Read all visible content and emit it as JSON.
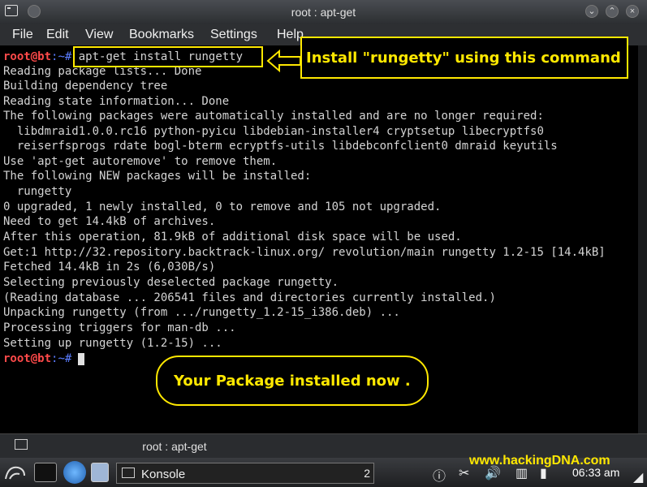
{
  "window": {
    "title": "root : apt-get",
    "menu": [
      "File",
      "Edit",
      "View",
      "Bookmarks",
      "Settings",
      "Help"
    ]
  },
  "terminal": {
    "prompt_user": "root@bt",
    "prompt_path": ":~#",
    "command": "apt-get install rungetty",
    "lines": [
      "Reading package lists... Done",
      "Building dependency tree",
      "Reading state information... Done",
      "The following packages were automatically installed and are no longer required:",
      "  libdmraid1.0.0.rc16 python-pyicu libdebian-installer4 cryptsetup libecryptfs0",
      "  reiserfsprogs rdate bogl-bterm ecryptfs-utils libdebconfclient0 dmraid keyutils",
      "Use 'apt-get autoremove' to remove them.",
      "The following NEW packages will be installed:",
      "  rungetty",
      "0 upgraded, 1 newly installed, 0 to remove and 105 not upgraded.",
      "Need to get 14.4kB of archives.",
      "After this operation, 81.9kB of additional disk space will be used.",
      "Get:1 http://32.repository.backtrack-linux.org/ revolution/main rungetty 1.2-15 [14.4kB]",
      "Fetched 14.4kB in 2s (6,030B/s)",
      "Selecting previously deselected package rungetty.",
      "(Reading database ... 206541 files and directories currently installed.)",
      "Unpacking rungetty (from .../rungetty_1.2-15_i386.deb) ...",
      "Processing triggers for man-db ...",
      "Setting up rungetty (1.2-15) ..."
    ]
  },
  "annotations": {
    "install_note": "Install  \"rungetty\" using this command",
    "done_note": "Your Package installed now ."
  },
  "tab": {
    "label": "root : apt-get"
  },
  "taskbar": {
    "task_label": "Konsole",
    "task_count": "2",
    "clock": "06:33 am"
  },
  "watermark": "www.hackingDNA.com",
  "colors": {
    "annotation": "#ffe800",
    "prompt": "#ff4a4a",
    "path": "#5a7cff"
  }
}
